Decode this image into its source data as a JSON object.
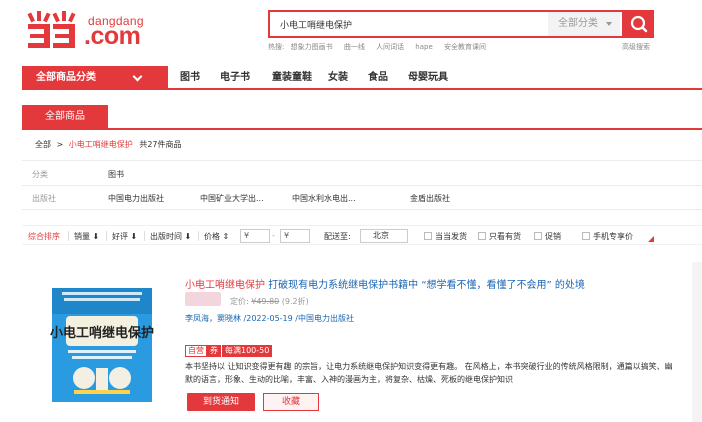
{
  "brand": {
    "name": "dangdang",
    "suffix": ".com",
    "accent": "#e4393c",
    "link": "#1a66b3"
  },
  "search": {
    "value": "小电工哨继电保护",
    "category": "全部分类",
    "hot_label": "热搜:",
    "hot_words": [
      "想象力图画书",
      "曲一线",
      "人间词话",
      "hape",
      "安全教育课间"
    ],
    "advanced": "高级搜索"
  },
  "nav": {
    "all_label": "全部商品分类",
    "links": [
      "图书",
      "电子书",
      "童装童鞋",
      "女装",
      "食品",
      "母婴玩具"
    ]
  },
  "tab_all": "全部商品",
  "breadcrumb": {
    "root": "全部",
    "sep": ">",
    "keyword": "小电工哨继电保护",
    "count_text": "共27件商品"
  },
  "filters": {
    "category_label": "分类",
    "category_value": "图书",
    "publisher_label": "出版社",
    "publishers": [
      "中国电力出版社",
      "中国矿业大学出...",
      "中国水利水电出...",
      "金盾出版社"
    ]
  },
  "sort_bar": {
    "items": [
      "综合排序",
      "销量",
      "好评",
      "出版时间",
      "价格"
    ],
    "price_placeholder": "¥",
    "deliver_label": "配送至:",
    "deliver_city": "北京",
    "checkboxes": [
      "当当发货",
      "只看有货",
      "促销",
      "手机专享价"
    ]
  },
  "product": {
    "title_keyword": "小电工哨继电保护",
    "title_rest": "打破现有电力系统继电保护书籍中 “想学看不懂，看懂了不会用” 的处境",
    "price_label": "定价:",
    "price_original": "¥49.80",
    "discount": "(9.2折)",
    "authors": "李凤海，窦晓林",
    "date_publisher": "/2022-05-19 /中国电力出版社",
    "tags": [
      "自营",
      "券",
      "每满100-50"
    ],
    "description": "本书坚持以 让知识变得更有趣 的宗旨，让电力系统继电保护知识变得更有趣。 在风格上，本书突破行业的传统风格限制，通篇以搞笑、幽默的语言，形象、生动的比喻，丰富、入神的漫画为主，将复杂、枯燥、死板的继电保护知识",
    "btn_notify": "到货通知",
    "btn_collect": "收藏",
    "cover_title": "小电工哨继电保护"
  }
}
